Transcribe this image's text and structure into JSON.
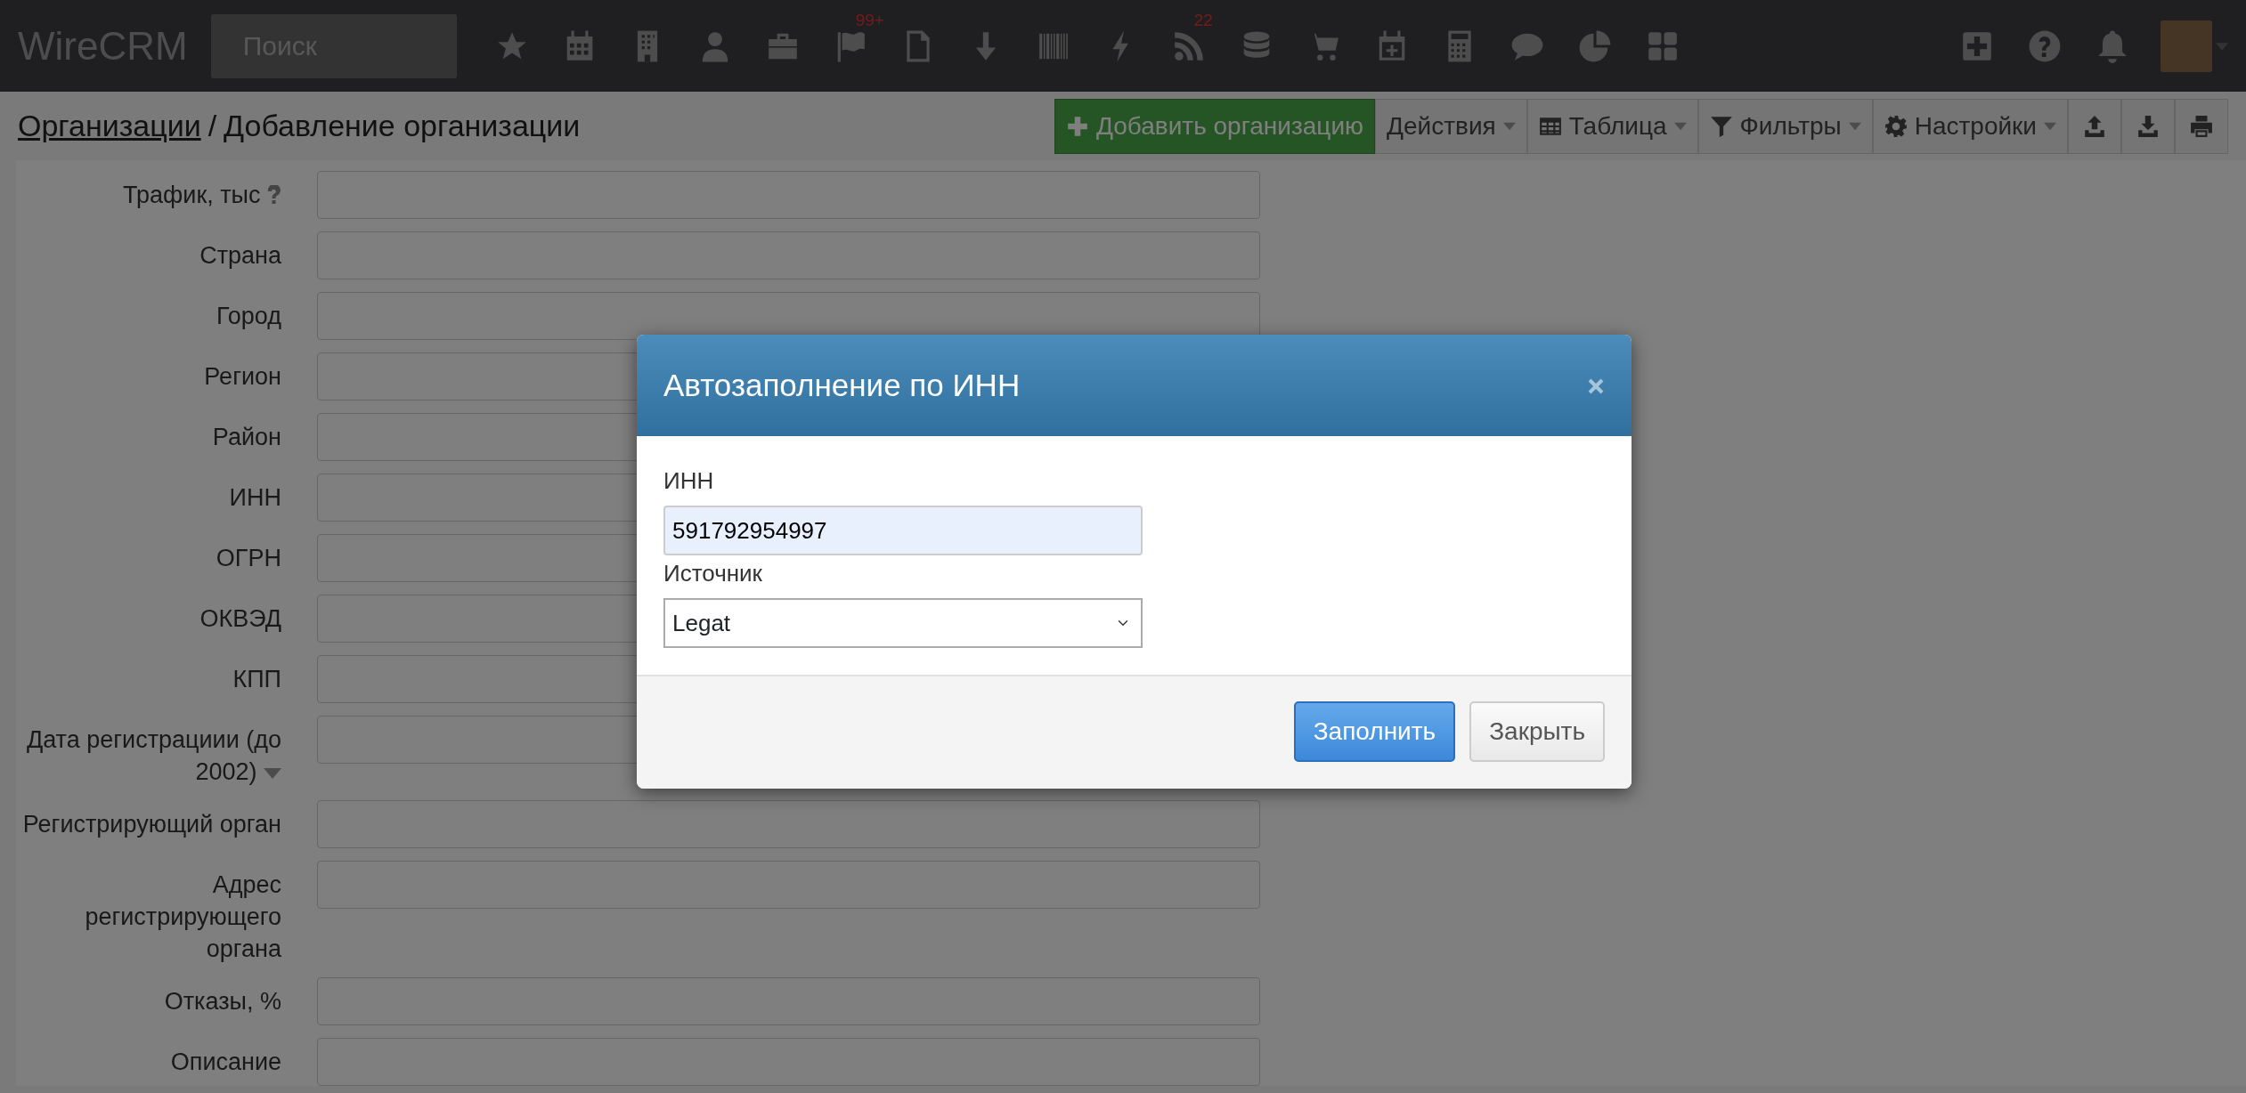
{
  "navbar": {
    "logo": "WireCRM",
    "search": {
      "placeholder": "Поиск"
    },
    "badges": [
      "99+",
      "22"
    ]
  },
  "breadcrumb": {
    "parent": "Организации",
    "separator": "/",
    "current": "Добавление организации"
  },
  "toolbar": {
    "primary": "Добавить организацию",
    "dropdowns": [
      {
        "label": "Действия",
        "kind": "plain"
      },
      {
        "label": "Таблица",
        "kind": "table"
      },
      {
        "label": "Фильтры",
        "kind": "filter"
      },
      {
        "label": "Настройки",
        "kind": "settings"
      }
    ],
    "icon_buttons": [
      {
        "kind": "upload"
      },
      {
        "kind": "download"
      },
      {
        "kind": "print"
      }
    ]
  },
  "form": {
    "fields": [
      {
        "label": "Трафик, тыс",
        "kind": "help"
      },
      {
        "label": "Страна",
        "kind": "plain"
      },
      {
        "label": "Город",
        "kind": "plain"
      },
      {
        "label": "Регион",
        "kind": "plain"
      },
      {
        "label": "Район",
        "kind": "plain"
      },
      {
        "label": "ИНН",
        "kind": "plain"
      },
      {
        "label": "ОГРН",
        "kind": "plain"
      },
      {
        "label": "ОКВЭД",
        "kind": "plain"
      },
      {
        "label": "КПП",
        "kind": "plain"
      },
      {
        "label": "Дата регистрациии (до 2002)",
        "kind": "dropdown"
      },
      {
        "label": "Регистрирующий орган",
        "kind": "plain"
      },
      {
        "label": "Адрес регистрирующего органа",
        "kind": "plain"
      },
      {
        "label": "Отказы, %",
        "kind": "plain"
      },
      {
        "label": "Описание",
        "kind": "plain"
      }
    ]
  },
  "modal": {
    "title": "Автозаполнение по ИНН",
    "inn_label": "ИНН",
    "inn_value": "591792954997",
    "source_label": "Источник",
    "source_value": "Legat",
    "buttons": [
      {
        "label": "Заполнить",
        "kind": "primary"
      },
      {
        "label": "Закрыть",
        "kind": "secondary"
      }
    ]
  }
}
